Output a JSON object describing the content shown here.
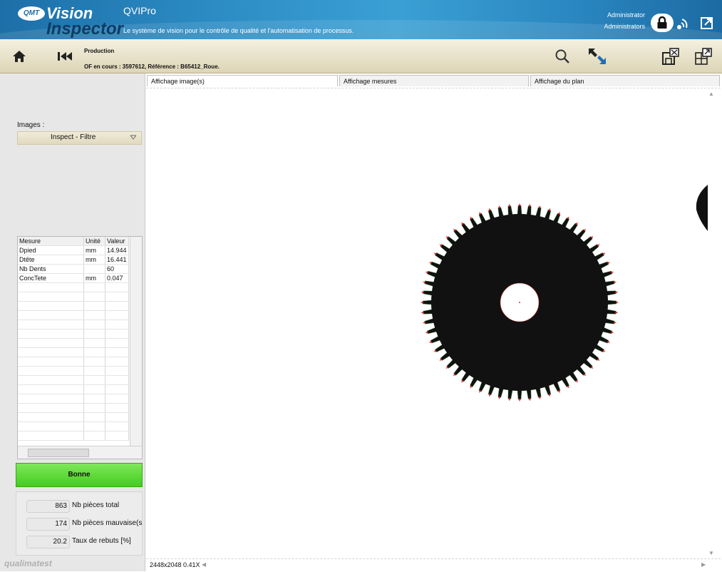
{
  "header": {
    "logo": {
      "badge": "QMT",
      "word1": "Vision",
      "word2": "Inspector"
    },
    "app_name": "QVIPro",
    "tagline": "Le système de vision pour le contrôle de qualité et l'automatisation de processus.",
    "user_name": "Administrator",
    "user_group": "Administrators"
  },
  "toolbar": {
    "production_label": "Production",
    "of_label": "OF en cours : 3597612, Référence : B65412_Roue."
  },
  "left_panel": {
    "images_label": "Images :",
    "images_select_value": "Inspect - Filtre",
    "grid": {
      "headers": [
        "Mesure",
        "Unité",
        "Valeur"
      ],
      "rows": [
        [
          "Dpied",
          "mm",
          "14.944"
        ],
        [
          "Dtête",
          "mm",
          "16.441"
        ],
        [
          "Nb Dents",
          "",
          "60"
        ],
        [
          "ConcTete",
          "mm",
          "0.047"
        ]
      ]
    },
    "status": "Bonne",
    "counters": [
      {
        "value": "863",
        "label": "Nb pièces total"
      },
      {
        "value": "174",
        "label": "Nb pièces mauvaise(s"
      },
      {
        "value": "20.2",
        "label": "Taux de rebuts [%]"
      }
    ],
    "brand": "qualimatest"
  },
  "tabs": [
    {
      "label": "Affichage image(s)",
      "active": true
    },
    {
      "label": "Affichage mesures",
      "active": false
    },
    {
      "label": "Affichage du plan",
      "active": false
    }
  ],
  "viewer": {
    "image_info": "2448x2048 0.41X",
    "gear_teeth": 60,
    "colors": {
      "gear": "#111111",
      "tooth_tip": "#cc2222",
      "status_green": "#45cc1f",
      "header_blue": "#2a86c0"
    }
  },
  "icons": [
    "home-icon",
    "first-page-icon",
    "zoom-icon",
    "fit-icon",
    "save-icon",
    "layout-icon",
    "lock-icon",
    "remote-icon",
    "exit-icon",
    "chevron-down-icon"
  ]
}
